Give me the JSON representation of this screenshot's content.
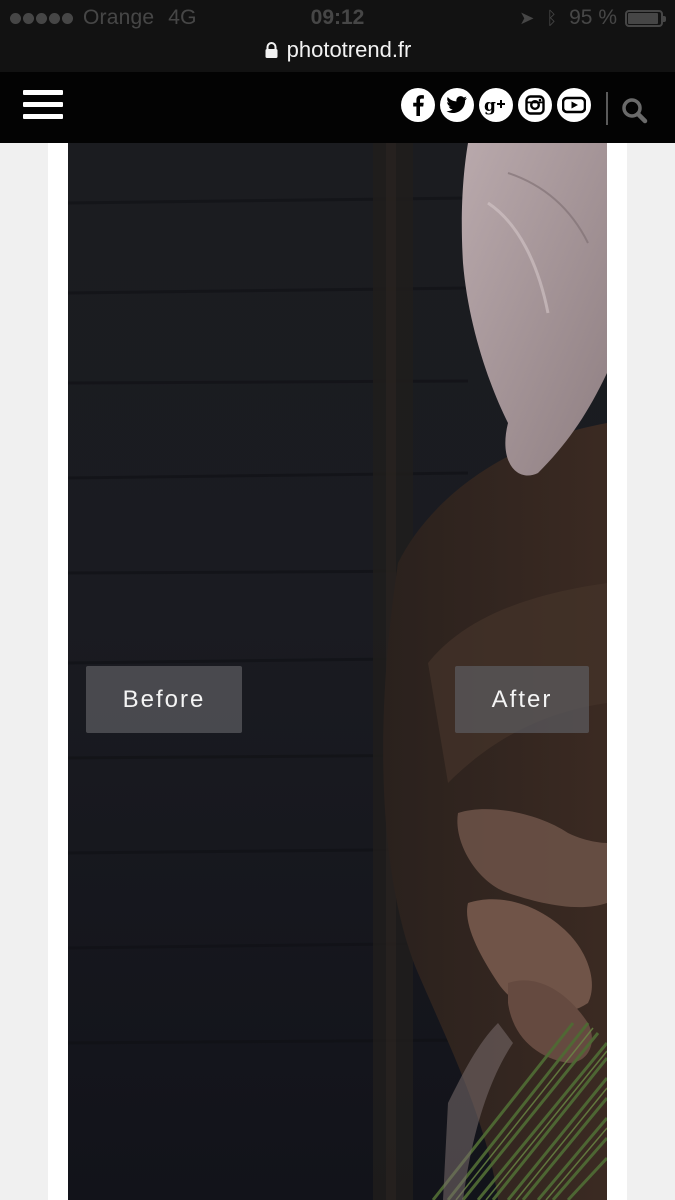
{
  "status_bar": {
    "carrier": "Orange",
    "network": "4G",
    "time": "09:12",
    "battery": "95 %"
  },
  "browser": {
    "url": "phototrend.fr"
  },
  "header": {
    "social_icons": [
      "facebook-icon",
      "twitter-icon",
      "google-plus-icon",
      "instagram-icon",
      "youtube-icon"
    ],
    "search_icon": "search-icon"
  },
  "comparison": {
    "before_label": "Before",
    "after_label": "After",
    "image_subject": "person in brown coat with white head scarf holding a bunch of green stems"
  }
}
